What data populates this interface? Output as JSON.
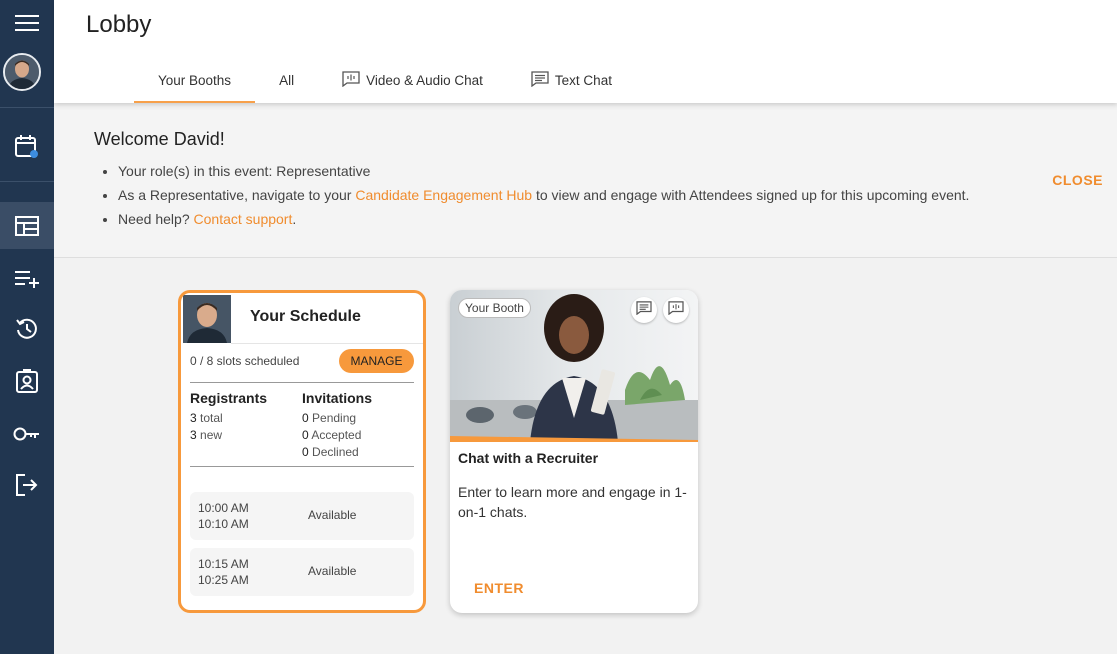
{
  "sidebar": {
    "items": [
      {
        "icon": "menu-icon"
      },
      {
        "icon": "calendar-icon"
      },
      {
        "icon": "dashboard-icon"
      },
      {
        "icon": "playlist-add-icon"
      },
      {
        "icon": "history-icon"
      },
      {
        "icon": "contact-badge-icon"
      },
      {
        "icon": "key-icon"
      },
      {
        "icon": "logout-icon"
      }
    ]
  },
  "header": {
    "title": "Lobby",
    "tabs": [
      {
        "label": "Your Booths",
        "active": true
      },
      {
        "label": "All"
      },
      {
        "label": "Video & Audio Chat",
        "icon": "video-chat-icon"
      },
      {
        "label": "Text Chat",
        "icon": "text-chat-icon"
      }
    ]
  },
  "welcome": {
    "title": "Welcome David!",
    "role_text": "Your role(s) in this event: Representative",
    "nav_prefix": "As a Representative, navigate to your",
    "nav_link": "Candidate Engagement Hub",
    "nav_suffix": "to view and engage with Attendees signed up for this upcoming event.",
    "help_prefix": "Need help?",
    "help_link": "Contact support",
    "help_suffix": ".",
    "close_label": "CLOSE"
  },
  "schedule": {
    "title": "Your Schedule",
    "slots_text": "0 / 8 slots scheduled",
    "manage_label": "MANAGE",
    "registrants": {
      "heading": "Registrants",
      "total_num": "3",
      "total_label": "total",
      "new_num": "3",
      "new_label": "new"
    },
    "invitations": {
      "heading": "Invitations",
      "pending_num": "0",
      "pending_label": "Pending",
      "accepted_num": "0",
      "accepted_label": "Accepted",
      "declined_num": "0",
      "declined_label": "Declined"
    },
    "slots": [
      {
        "start": "10:00 AM",
        "end": "10:10 AM",
        "status": "Available"
      },
      {
        "start": "10:15 AM",
        "end": "10:25 AM",
        "status": "Available"
      }
    ]
  },
  "booth": {
    "badge": "Your Booth",
    "title": "Chat with a Recruiter",
    "description": "Enter to learn more and engage in 1-on-1 chats.",
    "enter_label": "ENTER"
  },
  "colors": {
    "accent": "#f7993c",
    "link": "#f08c2e",
    "sidebar": "#213650"
  }
}
